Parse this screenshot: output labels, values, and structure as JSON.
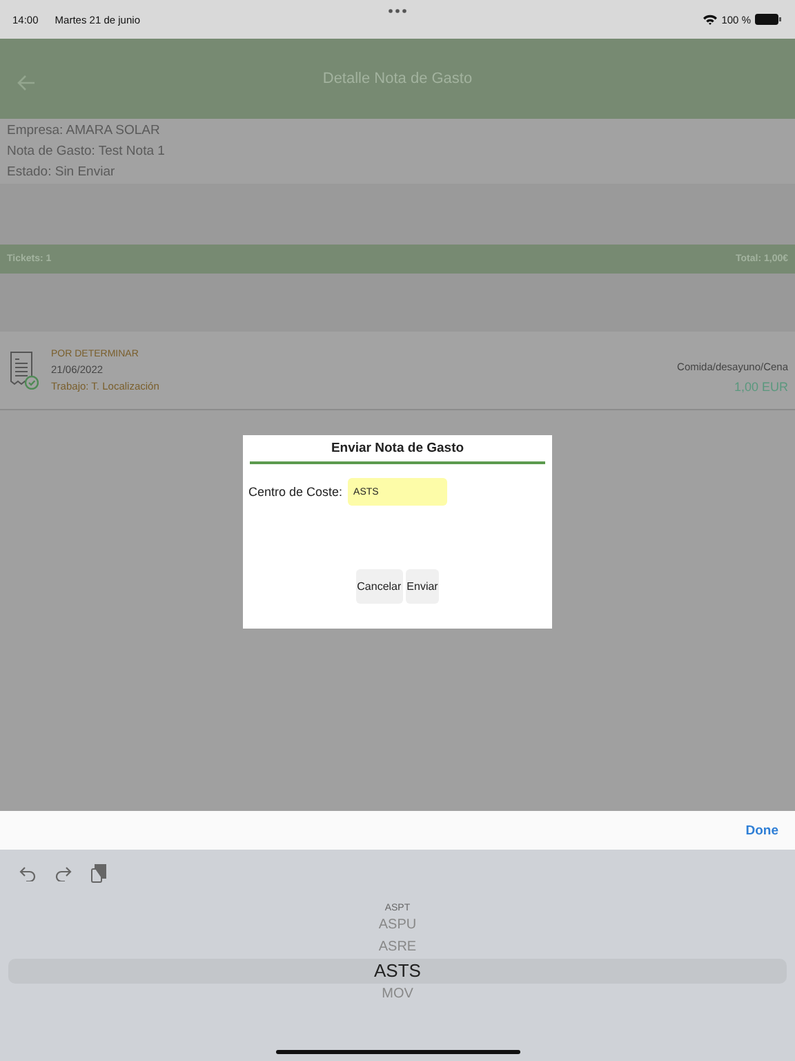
{
  "status_bar": {
    "time": "14:00",
    "date": "Martes 21 de junio",
    "battery": "100 %"
  },
  "header": {
    "title": "Detalle Nota de Gasto"
  },
  "info": [
    "Empresa: AMARA SOLAR",
    "Nota de Gasto: Test Nota 1",
    "Estado: Sin Enviar"
  ],
  "summary": {
    "tickets": "Tickets: 1",
    "total": "Total: 1,00€"
  },
  "tickets": [
    {
      "status": "POR DETERMINAR",
      "date": "21/06/2022",
      "project": "Trabajo: T. Localización",
      "category": "Comida/desayuno/Cena",
      "amount": "1,00 EUR",
      "verified": true
    }
  ],
  "dialog": {
    "title": "Enviar Nota de Gasto",
    "field_label": "Centro de Coste:",
    "field_value": "ASTS",
    "buttons": [
      "Cancelar",
      "Enviar"
    ]
  },
  "keyboard_toolbar": {
    "done": "Done"
  },
  "picker": [
    {
      "label": "ASPT",
      "selected": false
    },
    {
      "label": "ASPU",
      "selected": false
    },
    {
      "label": "ASRE",
      "selected": false
    },
    {
      "label": "ASTS",
      "selected": true
    },
    {
      "label": "MOV",
      "selected": false
    }
  ]
}
